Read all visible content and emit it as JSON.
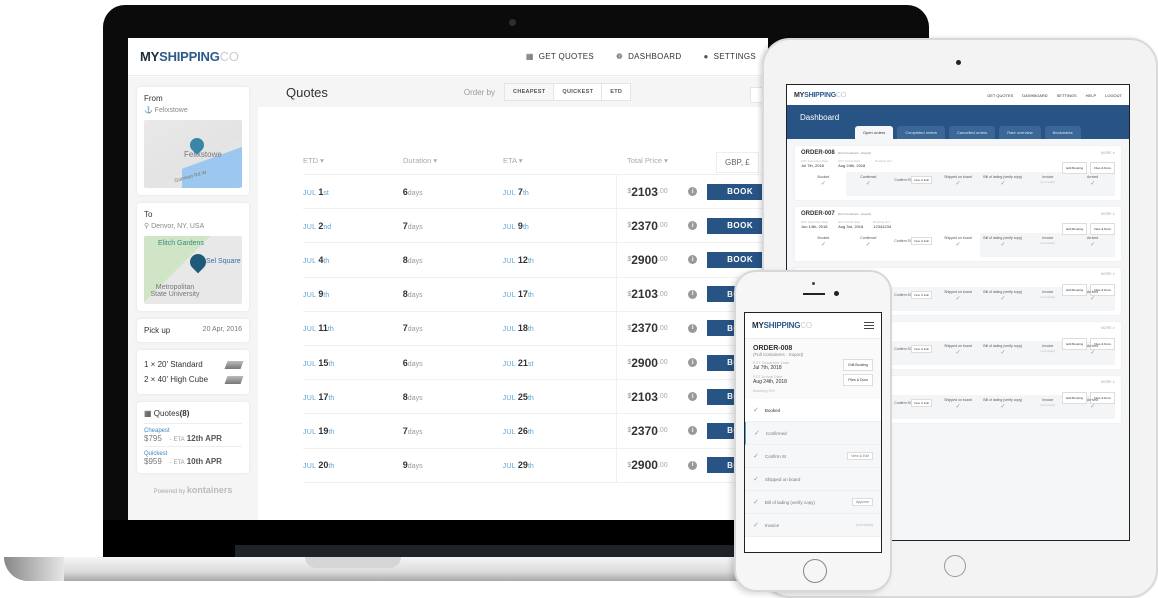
{
  "brand": {
    "my": "MY",
    "shipping": "SHIPPING",
    "co": "CO",
    "accent": "#275485",
    "link": "#5aa3d8"
  },
  "laptop": {
    "nav": [
      {
        "icon": "calculator-icon",
        "glyph": "▦",
        "label": "GET QUOTES"
      },
      {
        "icon": "dashboard-icon",
        "glyph": "❁",
        "label": "DASHBOARD"
      },
      {
        "icon": "gear-icon",
        "glyph": "●",
        "label": "SETTINGS"
      }
    ],
    "sidebar": {
      "from_label": "From",
      "from_value": "Felixstowe",
      "from_map_label": "Felixstowe",
      "from_map_road": "Garrison Rd W",
      "to_label": "To",
      "to_value": "Denvor, NY, USA",
      "to_map_labels": [
        "Elitch Gardens",
        "Sel Square",
        "Metropolitan State University"
      ],
      "pickup_label": "Pick up",
      "pickup_value": "20 Apr, 2016",
      "containers": [
        "1 × 20' Standard",
        "2 × 40' High Cube"
      ],
      "quotes_label": "Quotes",
      "quotes_count": "(8)",
      "quote_items": [
        {
          "tag": "Cheapest",
          "price": "$795",
          "eta_label": "- ETA",
          "eta": "12th APR"
        },
        {
          "tag": "Quickest",
          "price": "$959",
          "eta_label": "- ETA",
          "eta": "10th APR"
        }
      ],
      "powered_by": "Powered by",
      "powered_brand": "kontainers"
    },
    "main": {
      "title": "Quotes",
      "order_by": "Order by",
      "order_options": [
        "CHEAPEST",
        "QUICKEST",
        "ETD"
      ],
      "currency": "GBP, £",
      "columns": [
        "ETD ▾",
        "Duration ▾",
        "ETA ▾",
        "Total Price ▾"
      ],
      "book_label": "BOOK",
      "rows": [
        {
          "etd_m": "JUL",
          "etd_d": "1",
          "etd_s": "st",
          "dur": "6",
          "dur_u": "days",
          "eta_m": "JUL",
          "eta_d": "7",
          "eta_s": "th",
          "cur": "$",
          "price": "2103",
          "cents": ".00"
        },
        {
          "etd_m": "JUL",
          "etd_d": "2",
          "etd_s": "nd",
          "dur": "7",
          "dur_u": "days",
          "eta_m": "JUL",
          "eta_d": "9",
          "eta_s": "th",
          "cur": "$",
          "price": "2370",
          "cents": ".00"
        },
        {
          "etd_m": "JUL",
          "etd_d": "4",
          "etd_s": "th",
          "dur": "8",
          "dur_u": "days",
          "eta_m": "JUL",
          "eta_d": "12",
          "eta_s": "th",
          "cur": "$",
          "price": "2900",
          "cents": ".00"
        },
        {
          "etd_m": "JUL",
          "etd_d": "9",
          "etd_s": "th",
          "dur": "8",
          "dur_u": "days",
          "eta_m": "JUL",
          "eta_d": "17",
          "eta_s": "th",
          "cur": "$",
          "price": "2103",
          "cents": ".00"
        },
        {
          "etd_m": "JUL",
          "etd_d": "11",
          "etd_s": "th",
          "dur": "7",
          "dur_u": "days",
          "eta_m": "JUL",
          "eta_d": "18",
          "eta_s": "th",
          "cur": "$",
          "price": "2370",
          "cents": ".00"
        },
        {
          "etd_m": "JUL",
          "etd_d": "15",
          "etd_s": "th",
          "dur": "6",
          "dur_u": "days",
          "eta_m": "JUL",
          "eta_d": "21",
          "eta_s": "st",
          "cur": "$",
          "price": "2900",
          "cents": ".00"
        },
        {
          "etd_m": "JUL",
          "etd_d": "17",
          "etd_s": "th",
          "dur": "8",
          "dur_u": "days",
          "eta_m": "JUL",
          "eta_d": "25",
          "eta_s": "th",
          "cur": "$",
          "price": "2103",
          "cents": ".00"
        },
        {
          "etd_m": "JUL",
          "etd_d": "19",
          "etd_s": "th",
          "dur": "7",
          "dur_u": "days",
          "eta_m": "JUL",
          "eta_d": "26",
          "eta_s": "th",
          "cur": "$",
          "price": "2370",
          "cents": ".00"
        },
        {
          "etd_m": "JUL",
          "etd_d": "20",
          "etd_s": "th",
          "dur": "9",
          "dur_u": "days",
          "eta_m": "JUL",
          "eta_d": "29",
          "eta_s": "th",
          "cur": "$",
          "price": "2900",
          "cents": ".00"
        }
      ]
    }
  },
  "tablet": {
    "nav": [
      "GET QUOTES",
      "DASHBOARD",
      "SETTINGS",
      "HELP",
      "LOGOUT"
    ],
    "title": "Dashboard",
    "tabs": [
      "Open orders",
      "Completed orders",
      "Cancelled orders",
      "Rate overview",
      "Bookmarks"
    ],
    "more": "MORE ∨",
    "edit_booking": "Edit Booking",
    "files_docs": "Files & Docs",
    "orders": [
      {
        "id": "ORDER-008",
        "type": "(Full Containers - Export)",
        "dep_label": "EST Departure Date",
        "dep": "Jul 7th, 2018",
        "arr_label": "EST Arrival Date",
        "arr": "Aug 24th, 2018",
        "ref_label": "Booking Ref",
        "ref": ""
      },
      {
        "id": "ORDER-007",
        "type": "(Full Containers - Export)",
        "dep_label": "EST Departure Date",
        "dep": "Jun 14th, 2018",
        "arr_label": "EST Arrival Date",
        "arr": "Aug 3rd, 2018",
        "ref_label": "Booking Ref",
        "ref": "12341234"
      },
      {
        "id": "",
        "type": "",
        "dep_label": "",
        "dep": "",
        "arr_label": "",
        "arr": "",
        "ref_label": "Booking Ref",
        "ref": ""
      },
      {
        "id": "",
        "type": "",
        "dep_label": "",
        "dep": "",
        "arr_label": "",
        "arr": "",
        "ref_label": "Booking Ref",
        "ref": ""
      },
      {
        "id": "",
        "type": "",
        "dep_label": "",
        "dep": "",
        "arr_label": "",
        "arr": "",
        "ref_label": "Booking Ref",
        "ref": ""
      }
    ],
    "steps": [
      "Booked",
      "Confirmed",
      "Confirm SI",
      "Shipped on board",
      "Bill of lading (verify copy)",
      "Invoice",
      "Arrived"
    ],
    "step_actions": {
      "view_edit": "View & Edit",
      "approve": "Approve",
      "not_ready": "(not ready)"
    }
  },
  "phone": {
    "order_id": "ORDER-008",
    "order_type": "(Full Containers - Export)",
    "dep_label": "EST Departure Date",
    "dep": "Jul 7th, 2018",
    "arr_label": "EST Arrival Date",
    "arr": "Aug 24th, 2018",
    "ref_label": "Booking Ref",
    "edit_booking": "Edit Booking",
    "files_docs": "Files & Docs",
    "steps": [
      {
        "label": "Booked",
        "action": ""
      },
      {
        "label": "Confirmed",
        "action": ""
      },
      {
        "label": "Confirm SI",
        "action": "View & Edit"
      },
      {
        "label": "Shipped on board",
        "action": ""
      },
      {
        "label": "Bill of lading (verify copy)",
        "action": "Approve"
      },
      {
        "label": "Invoice",
        "action": "(not ready)"
      }
    ]
  }
}
